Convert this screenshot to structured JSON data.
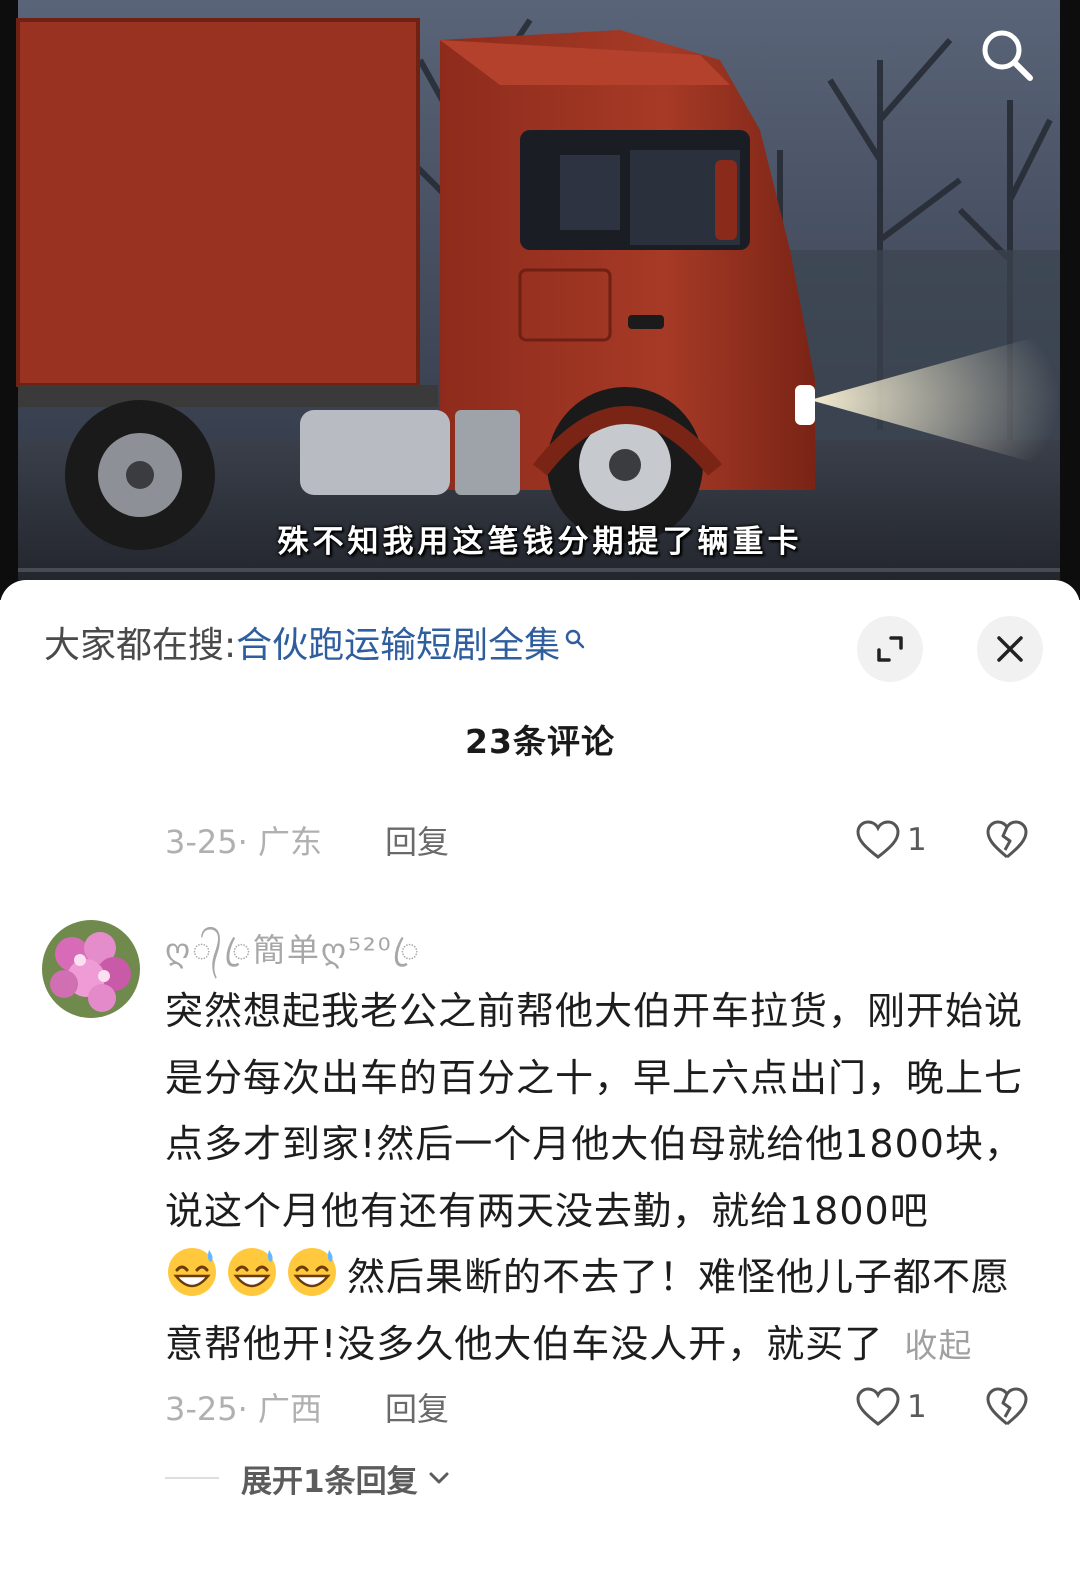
{
  "video": {
    "subtitle": "殊不知我用这笔钱分期提了辆重卡",
    "search_icon": "search-icon"
  },
  "sheet": {
    "hot_search_prefix": "大家都在搜:",
    "hot_search_query": "合伙跑运输短剧全集",
    "comment_count": "23条评论",
    "expand_icon": "expand-icon",
    "close_icon": "close-icon"
  },
  "comments": [
    {
      "date_loc": "3-25· 广东",
      "reply_label": "回复",
      "likes": "1"
    },
    {
      "username": "ღ᭄ꦿ簡单ღ⁵²⁰ꦿ",
      "text_part1": "突然想起我老公之前帮他大伯开车拉货，刚开始说是分每次出车的百分之十，早上六点出门，晚上七点多才到家!然后一个月他大伯母就给他1800块，说这个月他有还有两天没去勤，就给1800吧",
      "text_part2": "然后果断的不去了！难怪他儿子都不愿意帮他开!没多久他大伯车没人开，就买了",
      "emojis": [
        "grinning-sweat-emoji",
        "grinning-sweat-emoji",
        "grinning-sweat-emoji"
      ],
      "collapse_label": "收起",
      "date_loc": "3-25· 广西",
      "reply_label": "回复",
      "likes": "1",
      "expand_replies": "展开1条回复"
    }
  ],
  "colors": {
    "link": "#2f5e9e",
    "muted": "#b0b0b0",
    "truck": "#9a3020"
  }
}
